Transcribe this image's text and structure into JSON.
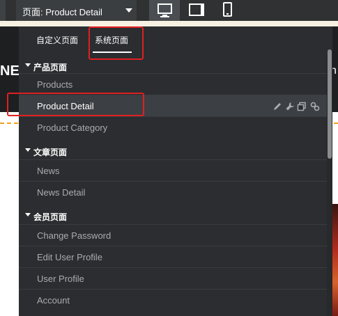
{
  "toolbar": {
    "page_select_label": "页面:  Product Detail",
    "devices": [
      {
        "name": "desktop",
        "icon": "desktop-icon",
        "active": true
      },
      {
        "name": "tablet",
        "icon": "tablet-icon",
        "active": false
      },
      {
        "name": "mobile",
        "icon": "mobile-icon",
        "active": false
      }
    ]
  },
  "background_page": {
    "brand_fragment": "NE",
    "nav_fragment": "n"
  },
  "dropdown": {
    "tabs": [
      {
        "label": "自定义页面",
        "selected": false
      },
      {
        "label": "系统页面",
        "selected": true
      }
    ],
    "groups": [
      {
        "title": "产品页面",
        "items": [
          "Products",
          "Product Detail",
          "Product Category"
        ]
      },
      {
        "title": "文章页面",
        "items": [
          "News",
          "News Detail"
        ]
      },
      {
        "title": "会员页面",
        "items": [
          "Change Password",
          "Edit User Profile",
          "User Profile",
          "Account"
        ]
      }
    ],
    "selected_item": "Product Detail",
    "row_actions": [
      "edit-icon",
      "settings-icon",
      "copy-icon",
      "link-icon"
    ]
  },
  "colors": {
    "toolbar_bg": "#2f3133",
    "panel_bg": "#2b2d30",
    "selected_row_bg": "#3c3f43",
    "highlight": "#e02020",
    "accent_dashed_line": "#f0a020"
  }
}
